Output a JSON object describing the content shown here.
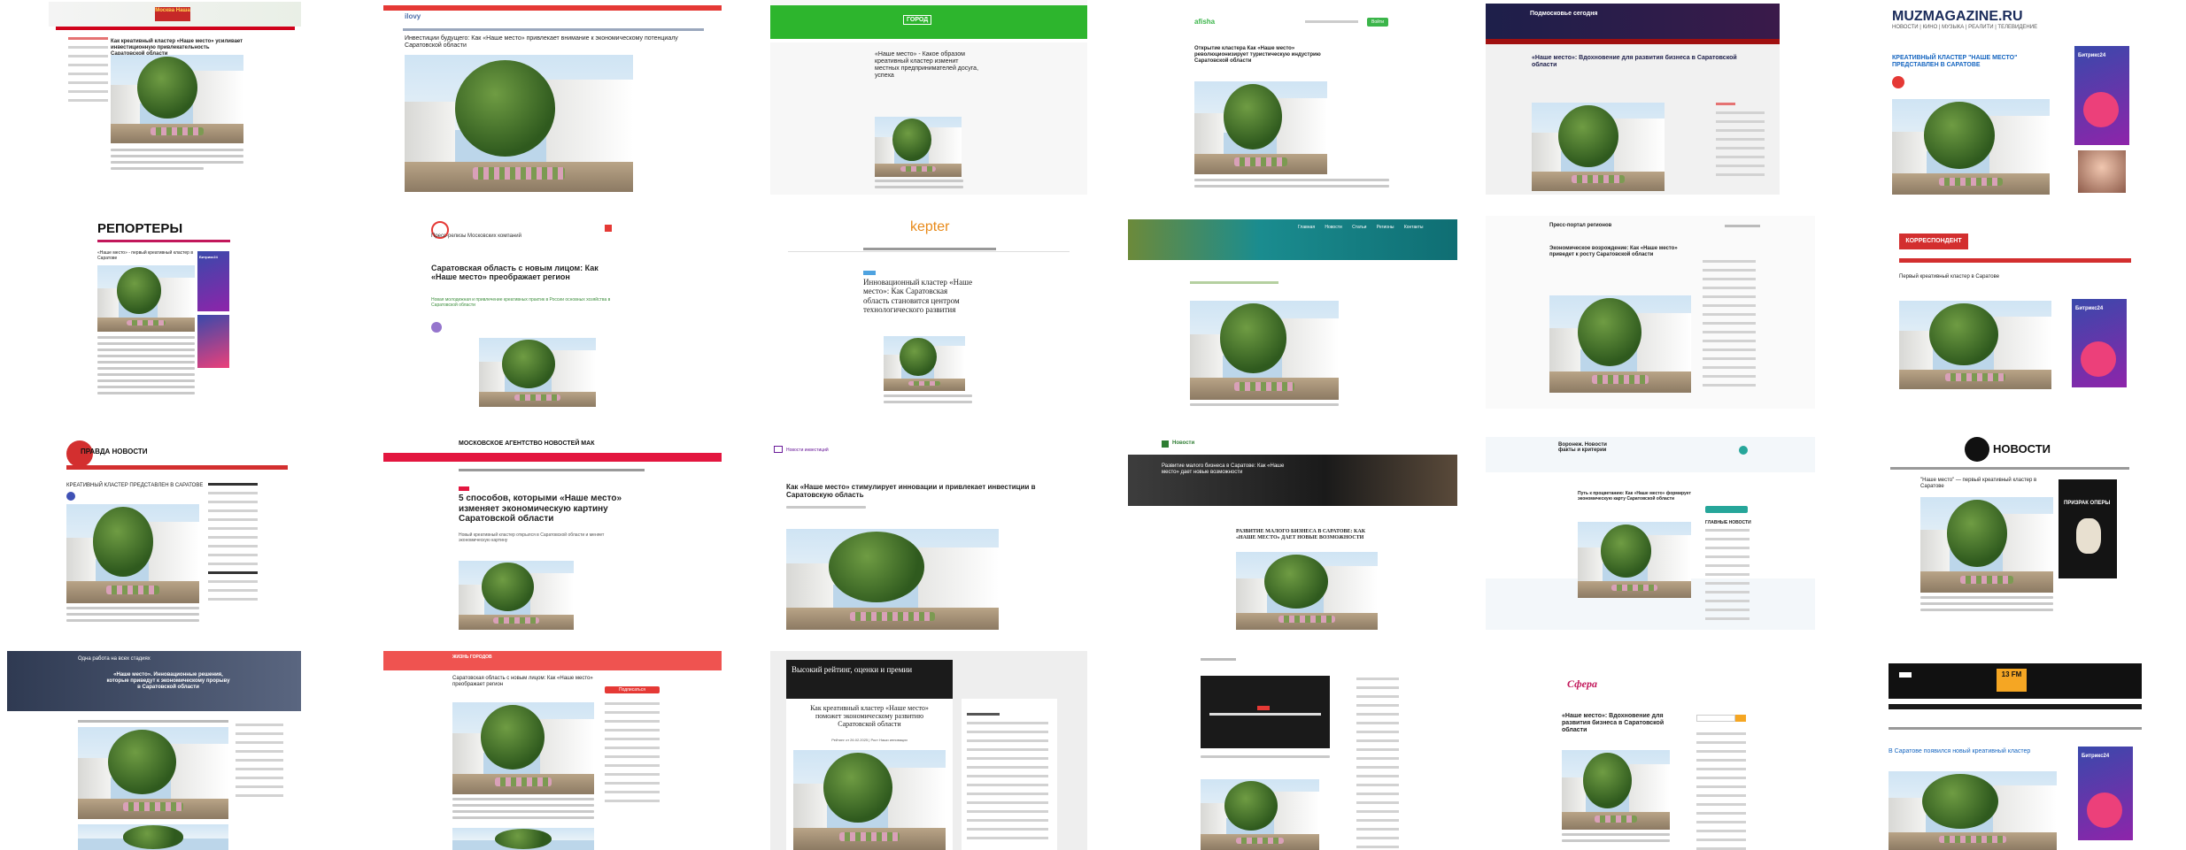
{
  "page": {
    "title": ""
  },
  "tiles": {
    "t1": {
      "logo": "Москва Наша",
      "title": "Как креативный кластер «Наше место» усиливает инвестиционную привлекательность Саратовской области",
      "accent": "#d0021b"
    },
    "t2": {
      "site": "ilovy",
      "title": "Инвестиции будущего: Как «Наше место» привлекает внимание к экономическому потенциалу Саратовской области",
      "accent": "#e53935"
    },
    "t3": {
      "logo": "ГОРОД",
      "title": "«Наше место» - Какое образом креативный кластер изменит местных предпринимателей досуга, успеха",
      "accent": "#2db52d"
    },
    "t4": {
      "logo": "afisha",
      "title": "Открытие кластера Как «Наше место» революционизирует туристическую индустрию Саратовской области",
      "accent": "#3bb54a",
      "button": "Войти"
    },
    "t5": {
      "logo": "Подмосковье сегодня",
      "title": "«Наше место»: Вдохновение для развития бизнеса в Саратовской области",
      "accent": "#a01010",
      "band": "#1d1f4a"
    },
    "t6": {
      "logo": "MUZMAGAZINE.RU",
      "nav": "НОВОСТИ | КИНО | МУЗЫКА | РЕАЛИТИ | ТЕЛЕВИДЕНИЕ",
      "title": "КРЕАТИВНЫЙ КЛАСТЕР \"НАШЕ МЕСТО\" ПРЕДСТАВЛЕН В САРАТОВЕ",
      "ad": "Битрикс24",
      "accent": "#1565c0"
    },
    "t7": {
      "logo": "РЕПОРТЕРЫ",
      "title": "«Наше место» - первый креативный кластер в Саратове",
      "ad": "Битрикс24",
      "accent": "#c2185b"
    },
    "t8": {
      "site": "Пресс-релизы Московских компаний",
      "title": "Саратовская область с новым лицом: Как «Наше место» преображает регион",
      "sub": "Новая молодежная и привлечение креативных практик в России основных хозяйства в Саратовской области",
      "accent": "#e53935"
    },
    "t9": {
      "logo": "kepter",
      "title": "Инновационный кластер «Наше место»: Как Саратовская область становится центром технологического развития",
      "accent": "#e88a1a"
    },
    "t10": {
      "logo": "",
      "nav": [
        "Главная",
        "Новости",
        "Статьи",
        "Регионы",
        "Контакты"
      ],
      "accent": "#0f6e73"
    },
    "t11": {
      "logo": "Пресс-портал регионов",
      "title": "Экономическое возрождение: Как «Наше место» приведет к росту Саратовской области",
      "accent": "#1565c0"
    },
    "t12": {
      "logo": "КОРРЕСПОНДЕНТ",
      "title": "Первый креативный кластер в Саратове",
      "ad": "Битрикс24",
      "accent": "#d32f2f"
    },
    "t13": {
      "logo": "ПРАВДА НОВОСТИ",
      "title": "КРЕАТИВНЫЙ КЛАСТЕР ПРЕДСТАВЛЕН В САРАТОВЕ",
      "accent": "#d32f2f"
    },
    "t14": {
      "logo": "МОСКОВСКОЕ АГЕНТСТВО НОВОСТЕЙ МАК",
      "title": "5 способов, которыми «Наше место» изменяет экономическую картину Саратовской области",
      "sub": "Новый креативный кластер открылся в Саратовской области и меняет экономическую картину",
      "accent": "#e3163f"
    },
    "t15": {
      "crumb": "Новости инвестиций",
      "title": "Как «Наше место» стимулирует инновации и привлекает инвестиции в Саратовскую область",
      "accent": "#6a1b9a"
    },
    "t16": {
      "logo": "Новости",
      "hero": "Развитие малого бизнеса в Саратове: Как «Наше место» дает новые возможности",
      "title": "РАЗВИТИЕ МАЛОГО БИЗНЕСА В САРАТОВЕ: КАК «НАШЕ МЕСТО» ДАЕТ НОВЫЕ ВОЗМОЖНОСТИ",
      "accent": "#2e7d32"
    },
    "t17": {
      "logo": "Воронеж. Новости факты и критерии",
      "title": "Путь к процветанию: Как «Наше место» формирует экономическую карту Саратовской области",
      "side": "ГЛАВНЫЕ НОВОСТИ",
      "accent": "#26a69a"
    },
    "t18": {
      "logo": "НОВОСТИ",
      "title": "\"Наше место\" — первый креативный кластер в Саратове",
      "ad": "ПРИЗРАК ОПЕРЫ",
      "accent": "#111111"
    },
    "t19": {
      "banner": "Одна работа на всех стадиях",
      "title": "«Наше место». Инновационные решения, которые приведут к экономическому прорыву в Саратовской области",
      "accent": "#3f4b63"
    },
    "t20": {
      "logo": "ЖИЗНЬ ГОРОДОВ",
      "title": "Саратовская область с новым лицом: Как «Наше место» преображает регион",
      "button": "Подписаться",
      "accent": "#e53935"
    },
    "t21": {
      "banner": "Высокий рейтинг, оценки и премии",
      "title": "Как креативный кластер «Наше место» поможет экономическому развитию Саратовской области",
      "date": "Рейтинг от 26.02.2025 | Рост Наши инновации",
      "accent": "#1b1b1b"
    },
    "t22": {
      "title": "",
      "accent": "#e53935"
    },
    "t23": {
      "logo": "Сфера",
      "title": "«Наше место»: Вдохновение для развития бизнеса в Саратовской области",
      "accent": "#c2185b"
    },
    "t24": {
      "logo": "13 FM",
      "title": "В Саратове появился новый креативный кластер",
      "ad": "Битрикс24",
      "accent": "#f5a623"
    }
  }
}
